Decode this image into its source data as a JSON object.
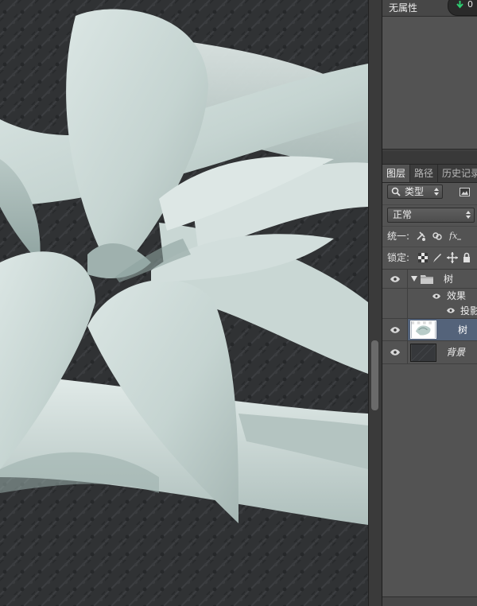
{
  "properties": {
    "no_properties_label": "无属性",
    "status_count": "0",
    "status_arrow_icon": "arrow-down-icon",
    "accent_color": "#2ecc71"
  },
  "layers_panel": {
    "tabs": [
      {
        "label": "图层",
        "active": true
      },
      {
        "label": "路径",
        "active": false
      },
      {
        "label": "历史记录",
        "active": false
      }
    ],
    "filter": {
      "label": "类型",
      "icon": "search-icon",
      "right_icon": "image-filter-icon"
    },
    "blend_mode": "正常",
    "unify_label": "统一:",
    "unify_icons": [
      "unify-position-icon",
      "unify-visibility-icon",
      "unify-style-icon"
    ],
    "lock_label": "锁定:",
    "lock_icons": [
      "lock-transparent-pixels-icon",
      "lock-image-pixels-icon",
      "lock-position-icon",
      "lock-all-icon"
    ],
    "layers": [
      {
        "name": "树",
        "kind": "group",
        "expanded": true,
        "visible": true
      },
      {
        "name": "效果",
        "kind": "effects",
        "visible": true
      },
      {
        "name": "投影",
        "kind": "effect",
        "visible": true
      },
      {
        "name": "树",
        "kind": "layer",
        "selected": true,
        "visible": true
      },
      {
        "name": "背景",
        "kind": "background",
        "visible": true
      }
    ],
    "selection_color": "#54637a"
  }
}
